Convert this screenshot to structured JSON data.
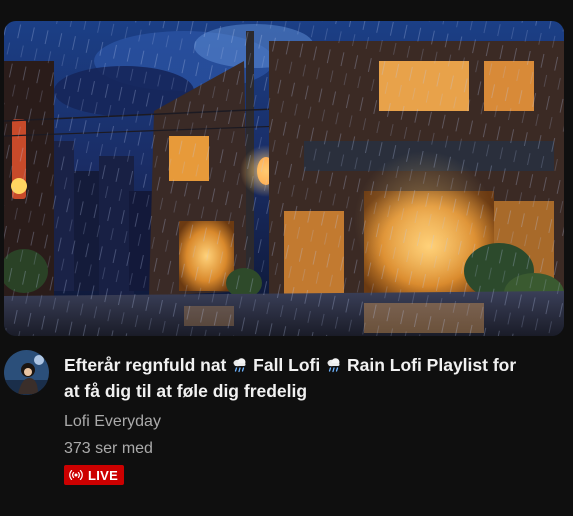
{
  "video": {
    "title_part1": "Efterår regnfuld nat",
    "title_part2": "Fall Lofi",
    "title_part3": "Rain Lofi Playlist for at få dig til at føle dig fredelig",
    "title_icon": "rain-cloud-icon",
    "channel": "Lofi Everyday",
    "viewers": "373 ser med",
    "live_label": "LIVE",
    "live_icon": "broadcast-icon"
  },
  "colors": {
    "background": "#0f0f0f",
    "title": "#f1f1f1",
    "secondary_text": "#aaaaaa",
    "live_badge": "#cc0000"
  }
}
